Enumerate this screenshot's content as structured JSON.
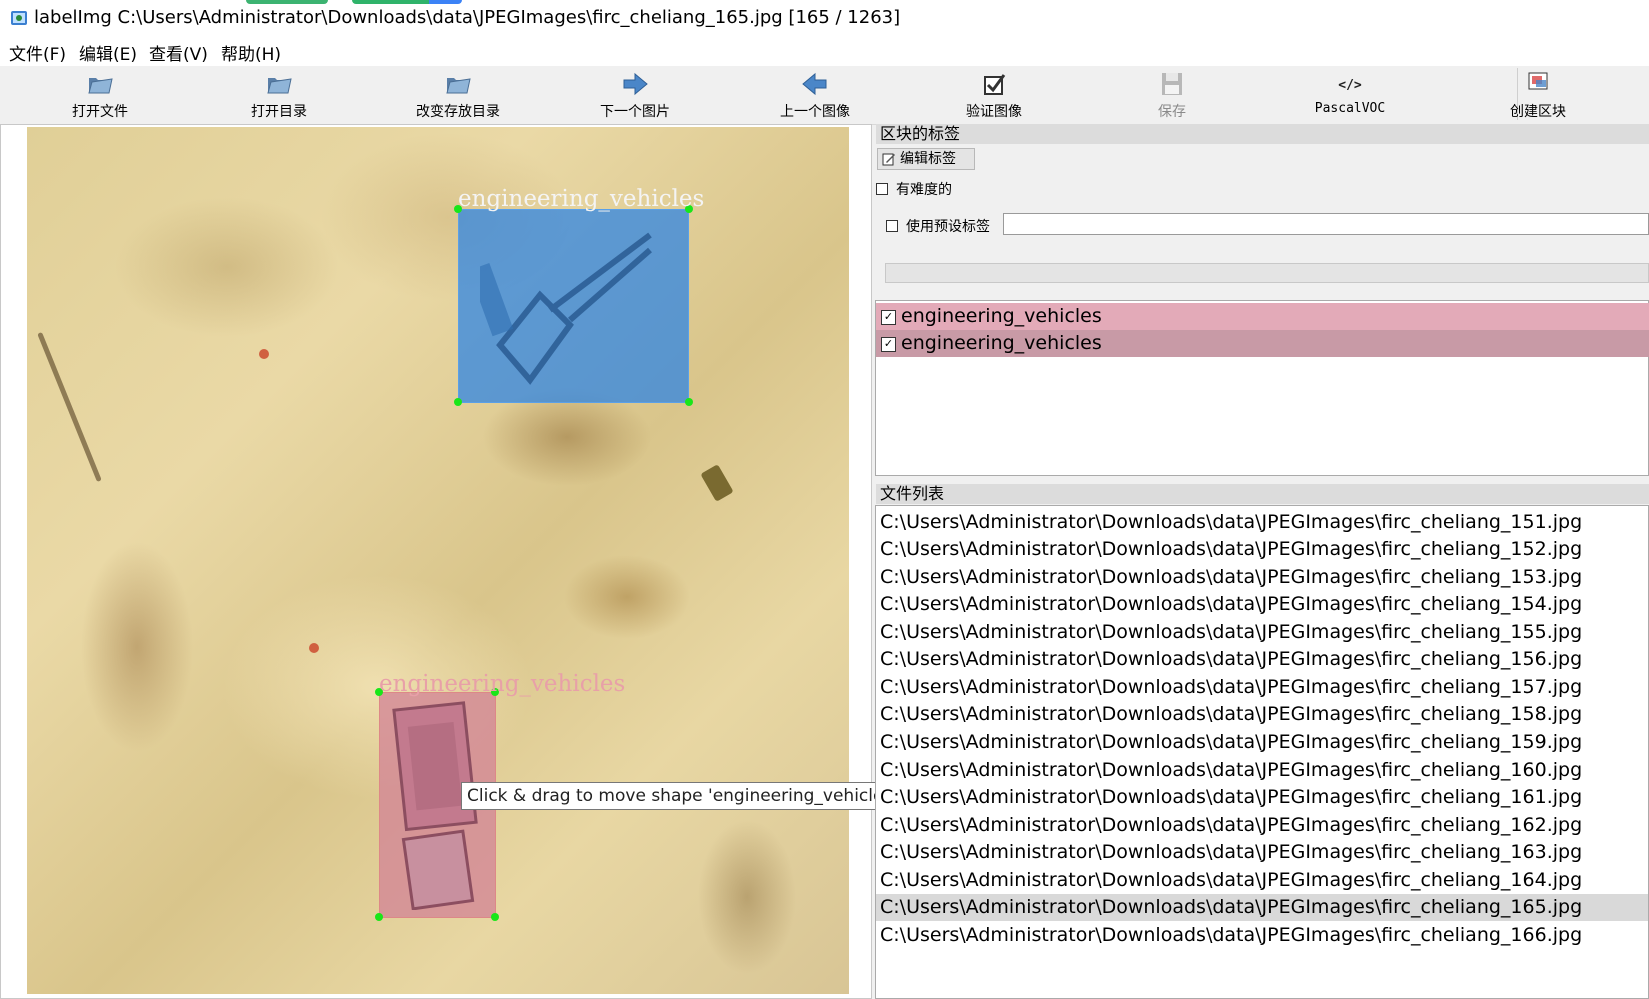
{
  "window": {
    "title": "labelImg C:\\Users\\Administrator\\Downloads\\data\\JPEGImages\\firc_cheliang_165.jpg [165 / 1263]"
  },
  "menu": [
    "文件(F)",
    "编辑(E)",
    "查看(V)",
    "帮助(H)"
  ],
  "toolbar": {
    "open_file": "打开文件",
    "open_dir": "打开目录",
    "change_save_dir": "改变存放目录",
    "next_image": "下一个图片",
    "prev_image": "上一个图像",
    "verify_image": "验证图像",
    "save": "保存",
    "format": "PascalVOC",
    "create_box": "创建区块"
  },
  "canvas": {
    "boxes": [
      {
        "label": "engineering_vehicles",
        "color": "#2882e6"
      },
      {
        "label": "engineering_vehicles",
        "color": "#d28296"
      }
    ],
    "tooltip": "Click & drag to move shape 'engineering_vehicles'"
  },
  "box_labels_panel": {
    "title": "区块的标签",
    "edit_label_button": "编辑标签",
    "difficult_label": "有难度的",
    "use_default_label": "使用预设标签",
    "default_label_value": "",
    "items": [
      {
        "label": "engineering_vehicles",
        "checked": true,
        "color": "#e3aab8"
      },
      {
        "label": "engineering_vehicles",
        "checked": true,
        "color": "#c89aa6"
      }
    ]
  },
  "file_list_panel": {
    "title": "文件列表",
    "files": [
      "C:\\Users\\Administrator\\Downloads\\data\\JPEGImages\\firc_cheliang_151.jpg",
      "C:\\Users\\Administrator\\Downloads\\data\\JPEGImages\\firc_cheliang_152.jpg",
      "C:\\Users\\Administrator\\Downloads\\data\\JPEGImages\\firc_cheliang_153.jpg",
      "C:\\Users\\Administrator\\Downloads\\data\\JPEGImages\\firc_cheliang_154.jpg",
      "C:\\Users\\Administrator\\Downloads\\data\\JPEGImages\\firc_cheliang_155.jpg",
      "C:\\Users\\Administrator\\Downloads\\data\\JPEGImages\\firc_cheliang_156.jpg",
      "C:\\Users\\Administrator\\Downloads\\data\\JPEGImages\\firc_cheliang_157.jpg",
      "C:\\Users\\Administrator\\Downloads\\data\\JPEGImages\\firc_cheliang_158.jpg",
      "C:\\Users\\Administrator\\Downloads\\data\\JPEGImages\\firc_cheliang_159.jpg",
      "C:\\Users\\Administrator\\Downloads\\data\\JPEGImages\\firc_cheliang_160.jpg",
      "C:\\Users\\Administrator\\Downloads\\data\\JPEGImages\\firc_cheliang_161.jpg",
      "C:\\Users\\Administrator\\Downloads\\data\\JPEGImages\\firc_cheliang_162.jpg",
      "C:\\Users\\Administrator\\Downloads\\data\\JPEGImages\\firc_cheliang_163.jpg",
      "C:\\Users\\Administrator\\Downloads\\data\\JPEGImages\\firc_cheliang_164.jpg",
      "C:\\Users\\Administrator\\Downloads\\data\\JPEGImages\\firc_cheliang_165.jpg",
      "C:\\Users\\Administrator\\Downloads\\data\\JPEGImages\\firc_cheliang_166.jpg"
    ],
    "selected_index": 14
  },
  "icons": {
    "app": "labelimg-app-icon",
    "open_file": "folder-open-icon",
    "open_dir": "folder-open-icon",
    "change_save_dir": "folder-open-icon",
    "next_image": "arrow-right-icon",
    "prev_image": "arrow-left-icon",
    "verify_image": "checkbox-check-icon",
    "save": "floppy-disk-icon",
    "format": "code-tag-icon",
    "create_box": "create-box-icon"
  }
}
